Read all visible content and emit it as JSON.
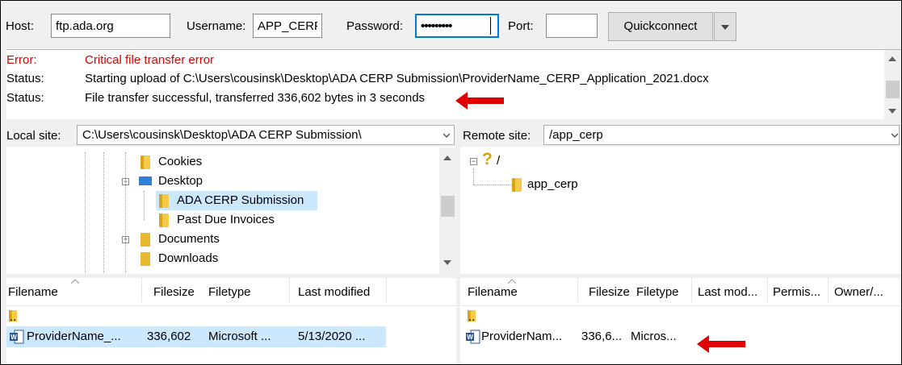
{
  "quickconnect": {
    "host_label": "Host:",
    "host_value": "ftp.ada.org",
    "username_label": "Username:",
    "username_value": "APP_CERP",
    "password_label": "Password:",
    "password_value": "•••••••••",
    "port_label": "Port:",
    "port_value": "",
    "quickconnect_label": "Quickconnect"
  },
  "log": [
    {
      "kind": "Error:",
      "text": "Critical file transfer error"
    },
    {
      "kind": "Status:",
      "text": "Starting upload of C:\\Users\\cousinsk\\Desktop\\ADA CERP Submission\\ProviderName_CERP_Application_2021.docx"
    },
    {
      "kind": "Status:",
      "text": "File transfer successful, transferred 336,602 bytes in 3 seconds"
    }
  ],
  "local": {
    "site_label": "Local site:",
    "site_path": "C:\\Users\\cousinsk\\Desktop\\ADA CERP Submission\\",
    "tree": [
      "Cookies",
      "Desktop",
      "ADA CERP Submission",
      "Past Due Invoices",
      "Documents",
      "Downloads"
    ],
    "columns": [
      "Filename",
      "Filesize",
      "Filetype",
      "Last modified"
    ],
    "parent_dir": "..",
    "files": [
      {
        "name": "ProviderName_...",
        "size": "336,602",
        "type": "Microsoft ...",
        "modified": "5/13/2020 ..."
      }
    ]
  },
  "remote": {
    "site_label": "Remote site:",
    "site_path": "/app_cerp",
    "tree_root": "/",
    "tree_root_icon": "?",
    "tree": [
      "app_cerp"
    ],
    "columns": [
      "Filename",
      "Filesize",
      "Filetype",
      "Last mod...",
      "Permis...",
      "Owner/..."
    ],
    "parent_dir": "..",
    "files": [
      {
        "name": "ProviderNam...",
        "size": "336,6...",
        "type": "Micros..."
      }
    ]
  },
  "colors": {
    "error_text": "#e00000",
    "annotation_arrow": "#e00000",
    "selection": "#cce8ff",
    "focus_border": "#0078d7"
  }
}
